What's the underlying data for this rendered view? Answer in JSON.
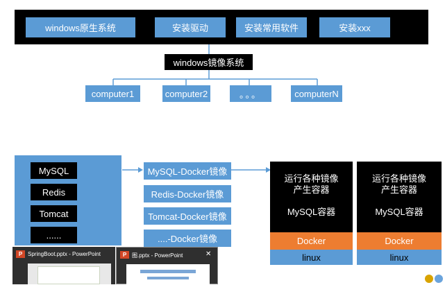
{
  "top_section": {
    "items": [
      "windows原生系统",
      "安装驱动",
      "安装常用软件",
      "安装xxx"
    ],
    "image_label": "windows镜像系统",
    "computers": [
      "computer1",
      "computer2",
      "。。。",
      "computerN"
    ]
  },
  "bottom_section": {
    "software": [
      "MySQL",
      "Redis",
      "Tomcat",
      "......"
    ],
    "images": [
      "MySQL-Docker镜像",
      "Redis-Docker镜像",
      "Tomcat-Docker镜像",
      "....-Docker镜像"
    ],
    "hosts": [
      {
        "line1": "运行各种镜像",
        "line2": "产生容器",
        "container": "MySQL容器",
        "docker": "Docker",
        "os": "linux"
      },
      {
        "line1": "运行各种镜像",
        "line2": "产生容器",
        "container": "MySQL容器",
        "docker": "Docker",
        "os": "linux"
      }
    ]
  },
  "taskbar": {
    "thumbs": [
      {
        "title": "SpringBoot.pptx - PowerPoint"
      },
      {
        "title": "图.pptx - PowerPoint"
      }
    ],
    "ppt_icon": "P",
    "close_icon": "✕"
  },
  "colors": {
    "blue": "#5b9bd5",
    "black": "#000000",
    "orange": "#ed7d31",
    "line": "#5b9bd5"
  }
}
